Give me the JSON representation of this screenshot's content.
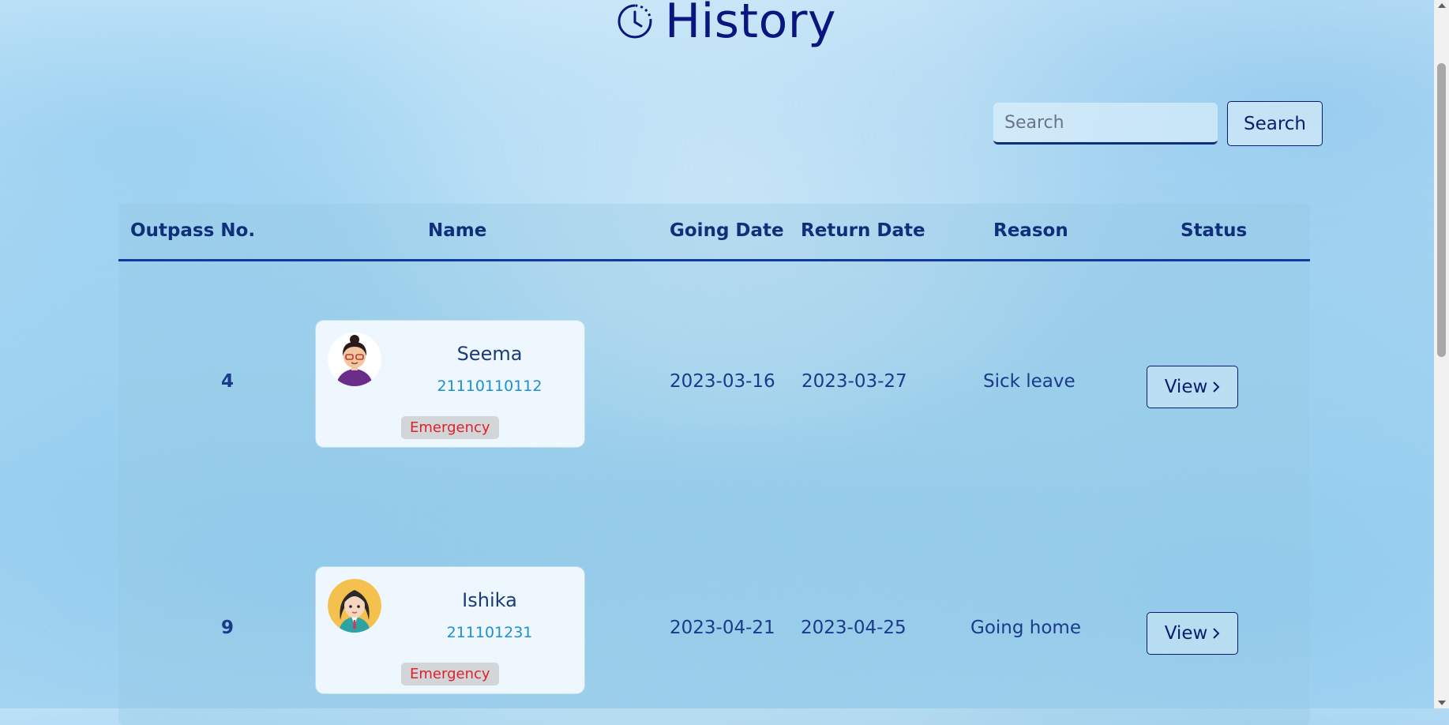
{
  "header": {
    "title": "History",
    "icon": "clock-icon"
  },
  "search": {
    "placeholder": "Search",
    "value": "",
    "button_label": "Search"
  },
  "table": {
    "columns": [
      "Outpass No.",
      "Name",
      "Going Date",
      "Return Date",
      "Reason",
      "Status"
    ],
    "rows": [
      {
        "outpass_no": "4",
        "name": "Seema",
        "id": "21110110112",
        "tag": "Emergency",
        "going_date": "2023-03-16",
        "return_date": "2023-03-27",
        "reason": "Sick leave",
        "status_label": "View",
        "avatar": "female-avatar-glasses"
      },
      {
        "outpass_no": "9",
        "name": "Ishika",
        "id": "211101231",
        "tag": "Emergency",
        "going_date": "2023-04-21",
        "return_date": "2023-04-25",
        "reason": "Going home",
        "status_label": "View",
        "avatar": "female-avatar-yellow"
      }
    ]
  },
  "colors": {
    "accent": "#0b1c6e",
    "tag_text": "#e0202a",
    "id_text": "#1e8fd0"
  }
}
